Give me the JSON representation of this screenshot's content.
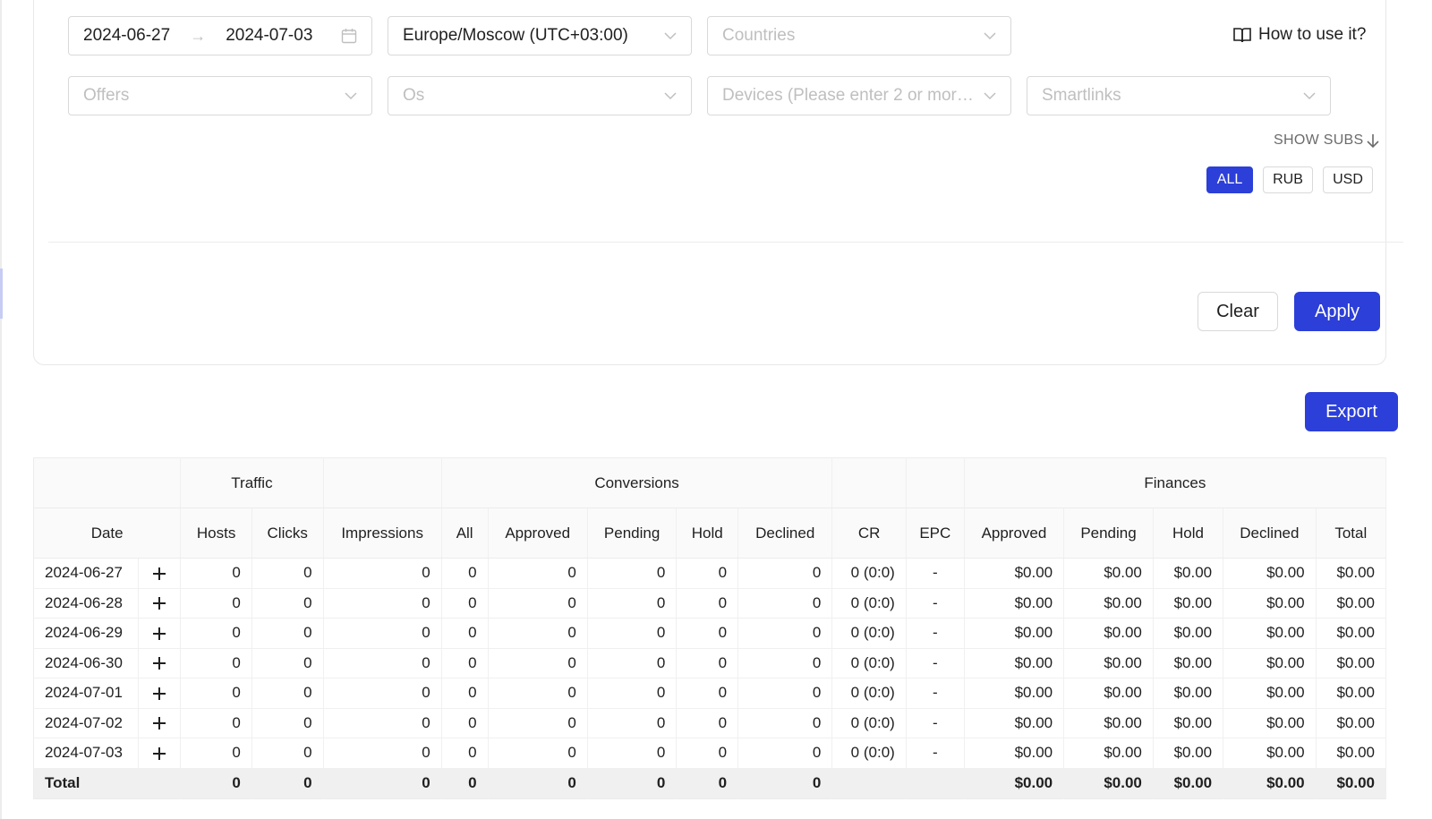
{
  "filters": {
    "date_start": "2024-06-27",
    "date_end": "2024-07-03",
    "timezone": "Europe/Moscow (UTC+03:00)",
    "countries_placeholder": "Countries",
    "offers_placeholder": "Offers",
    "os_placeholder": "Os",
    "devices_placeholder": "Devices (Please enter 2 or more ...",
    "smartlinks_placeholder": "Smartlinks",
    "how_to": "How to use it?",
    "show_subs": "SHOW SUBS",
    "currencies": [
      "ALL",
      "RUB",
      "USD"
    ],
    "active_currency": "ALL",
    "clear_label": "Clear",
    "apply_label": "Apply"
  },
  "export_label": "Export",
  "accent_color": "#2c3fd8",
  "table": {
    "groups": {
      "traffic": "Traffic",
      "conversions": "Conversions",
      "finances": "Finances"
    },
    "columns": [
      "Date",
      "Hosts",
      "Clicks",
      "Impressions",
      "All",
      "Approved",
      "Pending",
      "Hold",
      "Declined",
      "CR",
      "EPC",
      "Approved",
      "Pending",
      "Hold",
      "Declined",
      "Total"
    ],
    "rows": [
      {
        "date": "2024-06-27",
        "hosts": "0",
        "clicks": "0",
        "impressions": "0",
        "all": "0",
        "approved": "0",
        "pending": "0",
        "hold": "0",
        "declined": "0",
        "cr": "0 (0:0)",
        "epc": "-",
        "f_approved": "$0.00",
        "f_pending": "$0.00",
        "f_hold": "$0.00",
        "f_declined": "$0.00",
        "f_total": "$0.00"
      },
      {
        "date": "2024-06-28",
        "hosts": "0",
        "clicks": "0",
        "impressions": "0",
        "all": "0",
        "approved": "0",
        "pending": "0",
        "hold": "0",
        "declined": "0",
        "cr": "0 (0:0)",
        "epc": "-",
        "f_approved": "$0.00",
        "f_pending": "$0.00",
        "f_hold": "$0.00",
        "f_declined": "$0.00",
        "f_total": "$0.00"
      },
      {
        "date": "2024-06-29",
        "hosts": "0",
        "clicks": "0",
        "impressions": "0",
        "all": "0",
        "approved": "0",
        "pending": "0",
        "hold": "0",
        "declined": "0",
        "cr": "0 (0:0)",
        "epc": "-",
        "f_approved": "$0.00",
        "f_pending": "$0.00",
        "f_hold": "$0.00",
        "f_declined": "$0.00",
        "f_total": "$0.00"
      },
      {
        "date": "2024-06-30",
        "hosts": "0",
        "clicks": "0",
        "impressions": "0",
        "all": "0",
        "approved": "0",
        "pending": "0",
        "hold": "0",
        "declined": "0",
        "cr": "0 (0:0)",
        "epc": "-",
        "f_approved": "$0.00",
        "f_pending": "$0.00",
        "f_hold": "$0.00",
        "f_declined": "$0.00",
        "f_total": "$0.00"
      },
      {
        "date": "2024-07-01",
        "hosts": "0",
        "clicks": "0",
        "impressions": "0",
        "all": "0",
        "approved": "0",
        "pending": "0",
        "hold": "0",
        "declined": "0",
        "cr": "0 (0:0)",
        "epc": "-",
        "f_approved": "$0.00",
        "f_pending": "$0.00",
        "f_hold": "$0.00",
        "f_declined": "$0.00",
        "f_total": "$0.00"
      },
      {
        "date": "2024-07-02",
        "hosts": "0",
        "clicks": "0",
        "impressions": "0",
        "all": "0",
        "approved": "0",
        "pending": "0",
        "hold": "0",
        "declined": "0",
        "cr": "0 (0:0)",
        "epc": "-",
        "f_approved": "$0.00",
        "f_pending": "$0.00",
        "f_hold": "$0.00",
        "f_declined": "$0.00",
        "f_total": "$0.00"
      },
      {
        "date": "2024-07-03",
        "hosts": "0",
        "clicks": "0",
        "impressions": "0",
        "all": "0",
        "approved": "0",
        "pending": "0",
        "hold": "0",
        "declined": "0",
        "cr": "0 (0:0)",
        "epc": "-",
        "f_approved": "$0.00",
        "f_pending": "$0.00",
        "f_hold": "$0.00",
        "f_declined": "$0.00",
        "f_total": "$0.00"
      }
    ],
    "total": {
      "label": "Total",
      "hosts": "0",
      "clicks": "0",
      "impressions": "0",
      "all": "0",
      "approved": "0",
      "pending": "0",
      "hold": "0",
      "declined": "0",
      "f_approved": "$0.00",
      "f_pending": "$0.00",
      "f_hold": "$0.00",
      "f_declined": "$0.00",
      "f_total": "$0.00"
    }
  }
}
